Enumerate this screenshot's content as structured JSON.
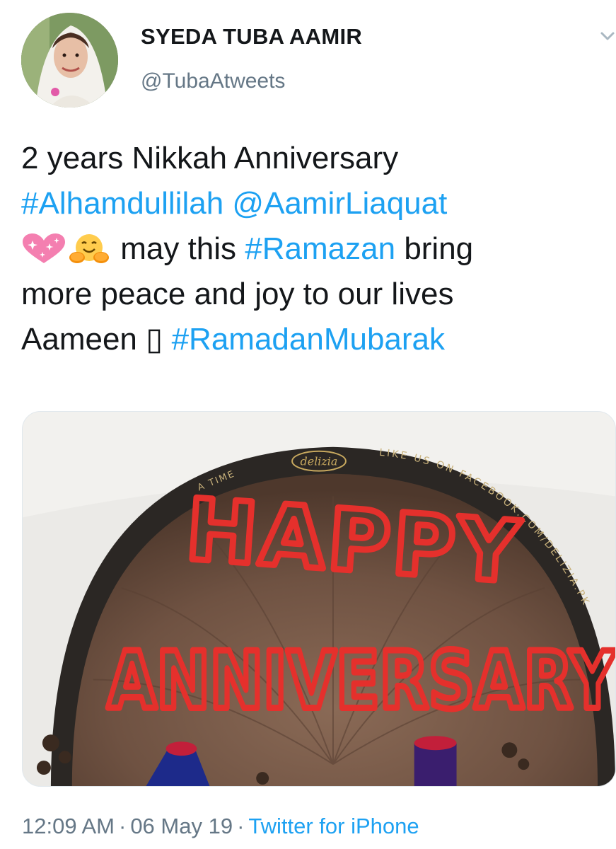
{
  "author": {
    "display_name": "SYEDA TUBA AAMIR",
    "handle": "@TubaAtweets",
    "avatar_icon": "profile-photo"
  },
  "tweet": {
    "line1": "2 years Nikkah Anniversary",
    "hashtag1": "#Alhamdullilah",
    "mention1": "@AamirLiaquat",
    "emoji1": "sparkling-heart",
    "emoji2": "hugging-face",
    "text_may_this": "may this",
    "hashtag2": "#Ramazan",
    "text_bring": "bring",
    "line4": "more peace and joy to our lives",
    "text_aameen": "Aameen",
    "missing_glyph": "▯",
    "hashtag3": "#RamadanMubarak"
  },
  "media": {
    "cake_text_line1": "HAPPY",
    "cake_text_line2": "ANNIVERSARY",
    "bakery_logo": "delizia",
    "board_text": "LIKE US ON FACEBOOK.COM/DELIZIA.PK",
    "board_text_left": "A TIME"
  },
  "footer": {
    "time": "12:09 AM",
    "separator": "·",
    "date": "06 May 19",
    "source": "Twitter for iPhone"
  },
  "colors": {
    "link": "#1da1f2",
    "secondary_text": "#657786",
    "primary_text": "#14171a"
  }
}
